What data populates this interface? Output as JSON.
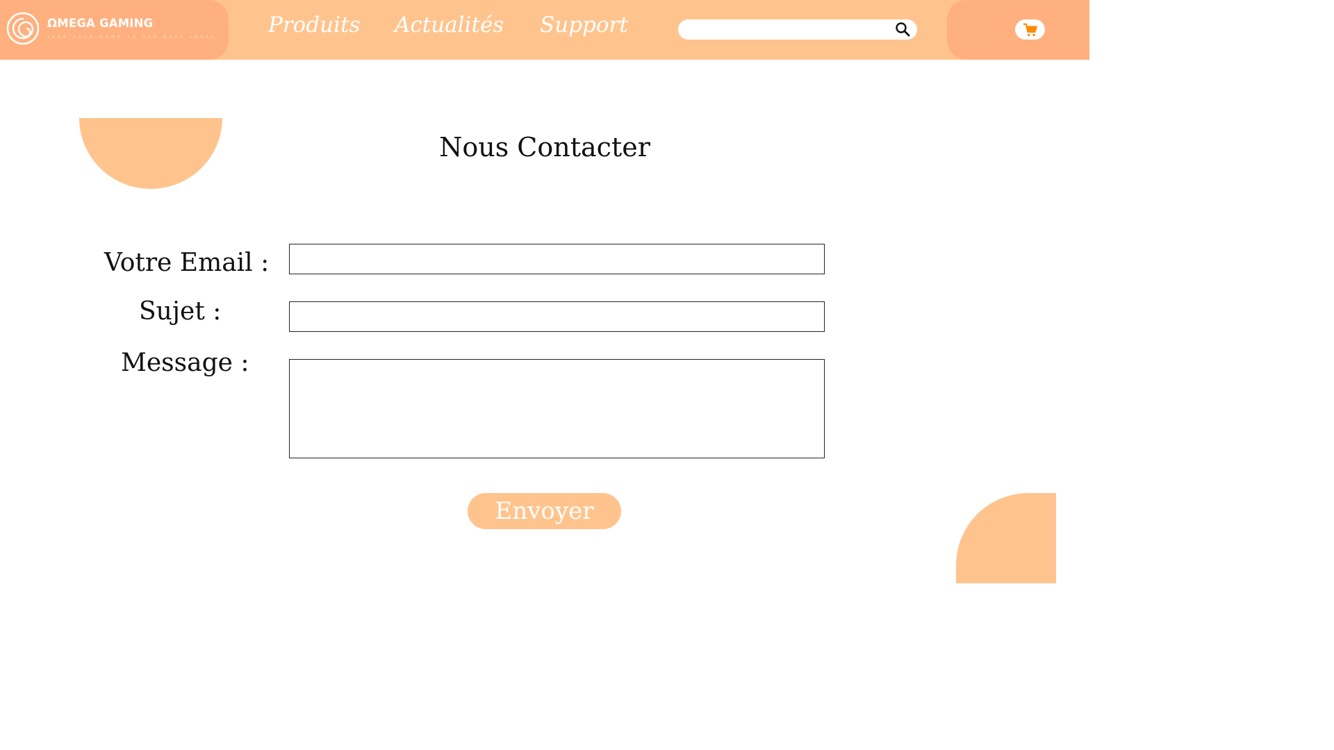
{
  "brand": {
    "name": "ΩMEGA GAMING",
    "tagline": "TAKE YOUR GAME TO THE NEXT LEVEL",
    "logo_icon": "omega-spiral-logo"
  },
  "nav": {
    "items": [
      {
        "label": "Produits"
      },
      {
        "label": "Actualités"
      },
      {
        "label": "Support"
      }
    ]
  },
  "search": {
    "value": "",
    "placeholder": "",
    "icon": "search-icon"
  },
  "cart": {
    "icon": "cart-icon"
  },
  "page": {
    "title": "Nous Contacter"
  },
  "form": {
    "email_label": "Votre Email :",
    "email_value": "",
    "subject_label": "Sujet :",
    "subject_value": "",
    "message_label": "Message :",
    "message_value": "",
    "submit_label": "Envoyer"
  },
  "colors": {
    "header": "#ffc48e",
    "header_accent": "#ffb07e",
    "cart_icon": "#ff8a00",
    "deco": "#ffc48e"
  }
}
